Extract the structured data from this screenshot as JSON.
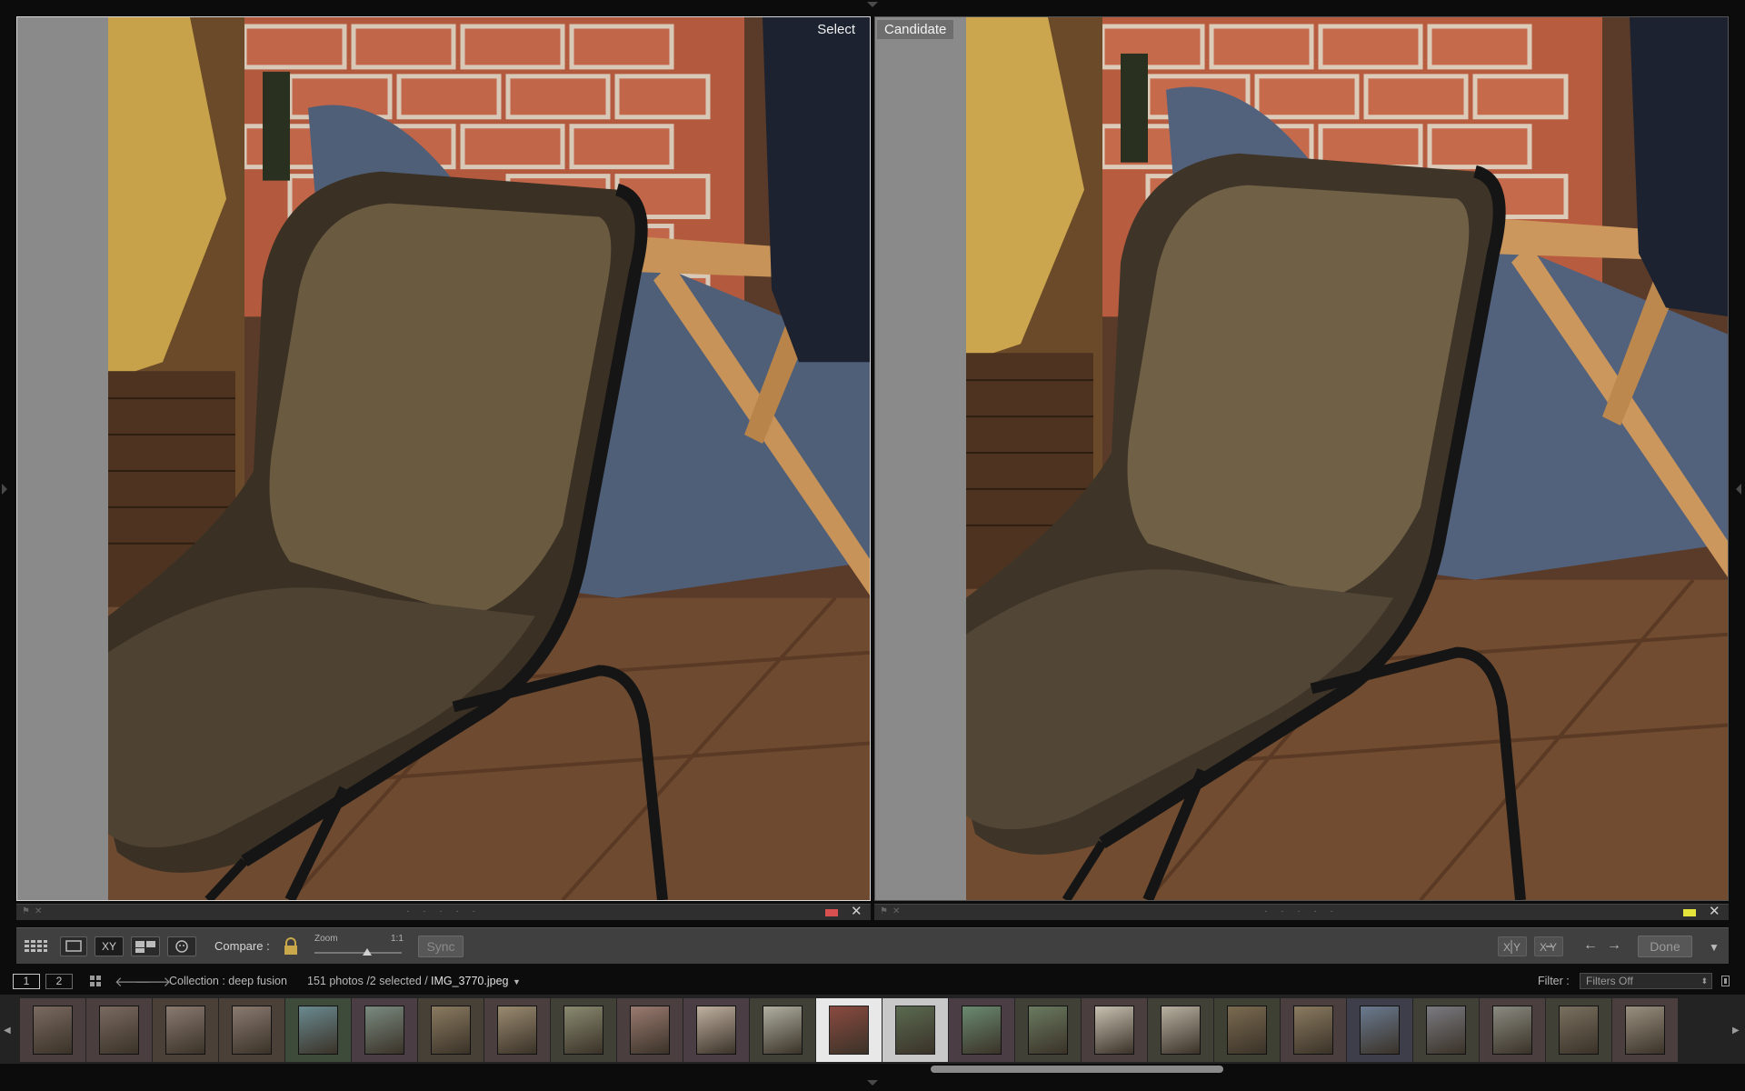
{
  "compare": {
    "select_label": "Select",
    "candidate_label": "Candidate"
  },
  "toolbar": {
    "compare_label": "Compare :",
    "zoom_label": "Zoom",
    "zoom_ratio": "1:1",
    "zoom_level": 0.6,
    "sync_label": "Sync",
    "done_label": "Done",
    "xy_label": "XY"
  },
  "pane_footer": {
    "dots": "· · · · ·",
    "left_color_label": "#e05050",
    "right_color_label": "#e6e63a"
  },
  "navbar": {
    "screen1": "1",
    "screen2": "2",
    "collection": "Collection : deep fusion",
    "count": "151 photos /2 selected /",
    "filename": "IMG_3770.jpeg",
    "filter_label": "Filter :",
    "filter_value": "Filters Off"
  },
  "filmstrip": {
    "thumbs": [
      {
        "tint": "#7a6a60",
        "bg": "#4a3e3e",
        "selected": false
      },
      {
        "tint": "#7a6a60",
        "bg": "#4a3e3e",
        "selected": false
      },
      {
        "tint": "#8a7a70",
        "bg": "#4a4038",
        "selected": false
      },
      {
        "tint": "#8a7a70",
        "bg": "#4a4038",
        "selected": false
      },
      {
        "tint": "#6a8a90",
        "bg": "#3e4a3a",
        "selected": false
      },
      {
        "tint": "#7a8a80",
        "bg": "#4a3e44",
        "selected": false
      },
      {
        "tint": "#8a7a60",
        "bg": "#464036",
        "selected": false
      },
      {
        "tint": "#9a8a70",
        "bg": "#4a3e3e",
        "selected": false
      },
      {
        "tint": "#8a8a70",
        "bg": "#404036",
        "selected": false
      },
      {
        "tint": "#9a7a70",
        "bg": "#4a3e3e",
        "selected": false
      },
      {
        "tint": "#c0b0a0",
        "bg": "#4a3e44",
        "selected": false
      },
      {
        "tint": "#b0b0a0",
        "bg": "#404036",
        "selected": false
      },
      {
        "tint": "#8a4a40",
        "bg": "#e8e8e8",
        "selected": true
      },
      {
        "tint": "#5a6a50",
        "bg": "#c8c8c8",
        "selected": true
      },
      {
        "tint": "#6a8a70",
        "bg": "#4a3e44",
        "selected": false
      },
      {
        "tint": "#6a7a60",
        "bg": "#404036",
        "selected": false
      },
      {
        "tint": "#c8c0b0",
        "bg": "#4a3e3e",
        "selected": false
      },
      {
        "tint": "#b8b0a0",
        "bg": "#404036",
        "selected": false
      },
      {
        "tint": "#7a6a50",
        "bg": "#3e4034",
        "selected": false
      },
      {
        "tint": "#8a7a60",
        "bg": "#4a3e3e",
        "selected": false
      },
      {
        "tint": "#6a7a90",
        "bg": "#3e3e4a",
        "selected": false
      },
      {
        "tint": "#7a7a80",
        "bg": "#404036",
        "selected": false
      },
      {
        "tint": "#8a8a80",
        "bg": "#4a3e3e",
        "selected": false
      },
      {
        "tint": "#7a7060",
        "bg": "#404036",
        "selected": false
      },
      {
        "tint": "#9a9080",
        "bg": "#4a3e3e",
        "selected": false
      }
    ]
  }
}
